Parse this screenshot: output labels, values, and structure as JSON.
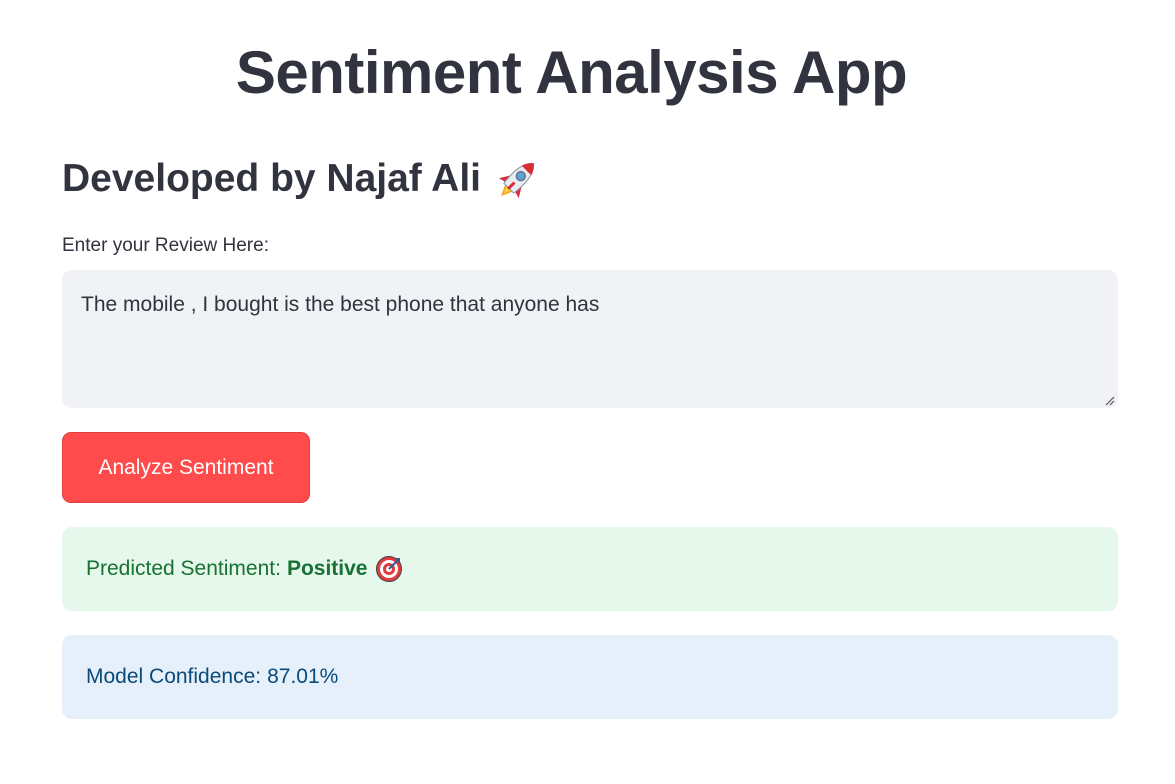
{
  "header": {
    "title": "Sentiment Analysis App",
    "subtitle": "Developed by Najaf Ali",
    "subtitle_icon": "rocket-icon"
  },
  "review_input": {
    "label": "Enter your Review Here:",
    "value": "The mobile , I bought is the best phone that anyone has"
  },
  "analyze_button": {
    "label": "Analyze Sentiment",
    "color": "#ff4b4b"
  },
  "result": {
    "prediction_label": "Predicted Sentiment:",
    "prediction_value": "Positive",
    "prediction_icon": "target-icon",
    "success_bg": "#e6f7ec",
    "success_text": "#177233",
    "confidence_label": "Model Confidence:",
    "confidence_value": "87.01%",
    "info_bg": "#e6f0fb",
    "info_text": "#0a4a7a"
  }
}
